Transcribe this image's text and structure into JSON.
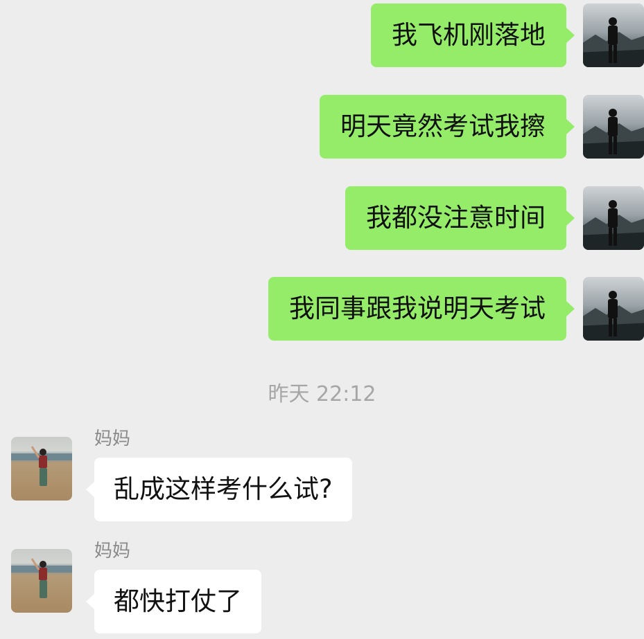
{
  "outgoing_messages": [
    {
      "text": "我飞机刚落地"
    },
    {
      "text": "明天竟然考试我擦"
    },
    {
      "text": "我都没注意时间"
    },
    {
      "text": "我同事跟我说明天考试"
    }
  ],
  "timestamp": "昨天 22:12",
  "incoming_messages": [
    {
      "sender": "妈妈",
      "text": "乱成这样考什么试?"
    },
    {
      "sender": "妈妈",
      "text": "都快打仗了"
    }
  ],
  "colors": {
    "background": "#ededed",
    "outgoing_bubble": "#95ec69",
    "incoming_bubble": "#ffffff",
    "timestamp_text": "#a6a6a6"
  }
}
